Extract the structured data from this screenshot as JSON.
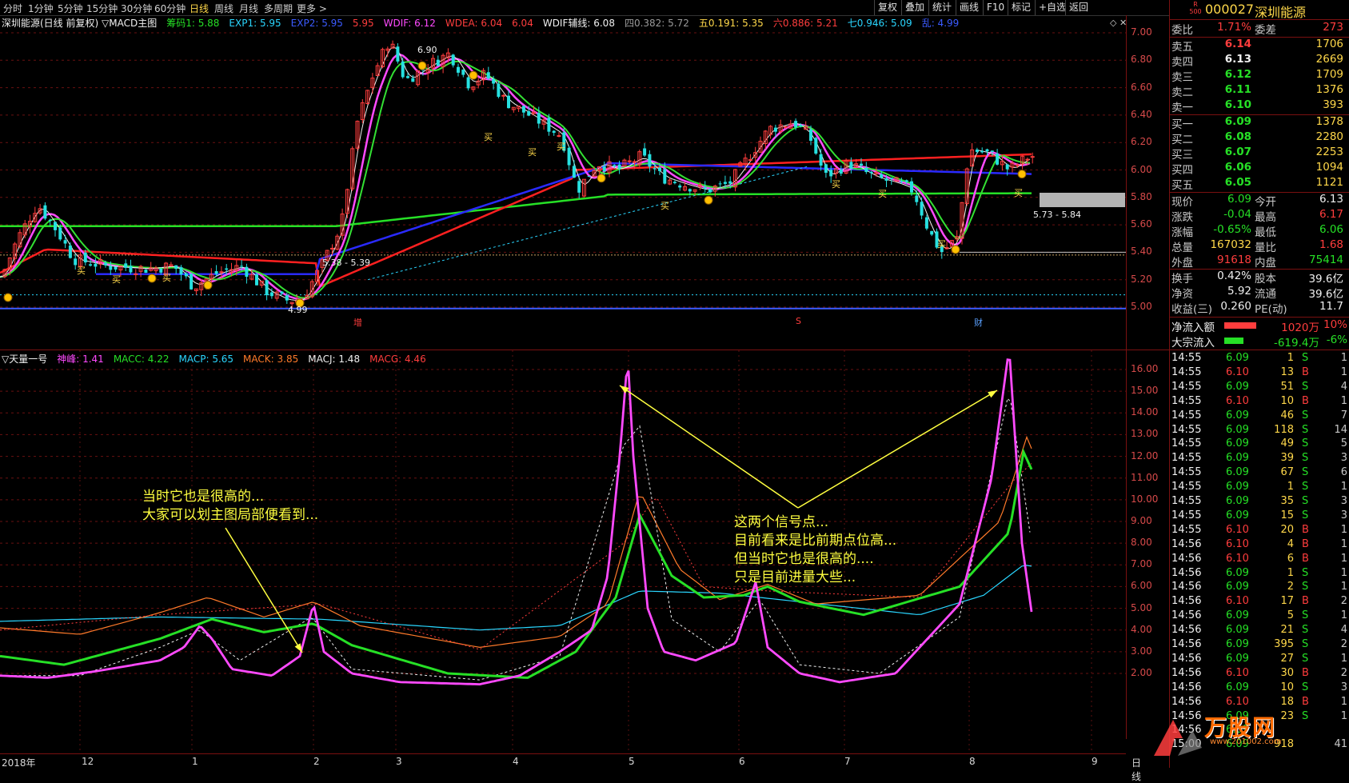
{
  "toolbar": {
    "periods": [
      "分时",
      "1分钟",
      "5分钟",
      "15分钟",
      "30分钟",
      "60分钟",
      "日线",
      "周线",
      "月线",
      "多周期",
      "更多 >"
    ],
    "active_period": "日线",
    "right_buttons": [
      "复权",
      "叠加",
      "统计",
      "画线",
      "F10",
      "标记",
      "+自选",
      "返回"
    ]
  },
  "main_header": {
    "title": "深圳能源(日线 前复权) ▽MACD主图",
    "items": [
      {
        "text": "筹码1: 5.88",
        "color": "#26e026"
      },
      {
        "text": "EXP1: 5.95",
        "color": "#2ad6ff"
      },
      {
        "text": "EXP2: 5.95",
        "color": "#3b5bff"
      },
      {
        "text": "5.95",
        "color": "#ff3d3d"
      },
      {
        "text": "WDIF: 6.12",
        "color": "#ff4aff"
      },
      {
        "text": "WDEA: 6.04",
        "color": "#ff3d3d"
      },
      {
        "text": "6.04",
        "color": "#ff3d3d"
      },
      {
        "text": "WDIF辅线: 6.08",
        "color": "#f0f0f0"
      },
      {
        "text": "四0.382: 5.72",
        "color": "#9a9a9a"
      },
      {
        "text": "五0.191: 5.35",
        "color": "#ffd84a"
      },
      {
        "text": "六0.886: 5.21",
        "color": "#ff3d3d"
      },
      {
        "text": "七0.946: 5.09",
        "color": "#2ad6ff"
      },
      {
        "text": "乱: 4.99",
        "color": "#3b5bff"
      }
    ]
  },
  "main_yaxis": [
    "7.00",
    "6.80",
    "6.60",
    "6.40",
    "6.20",
    "6.00",
    "5.80",
    "5.60",
    "5.40",
    "5.20",
    "5.00"
  ],
  "main_labels": {
    "high": "6.90",
    "low": "4.99",
    "mid": "5.38 - 5.39",
    "range_right": "5.73 - 5.84",
    "buy": "买",
    "marker_zeng": "增",
    "marker_s": "S",
    "marker_cai": "财"
  },
  "ind_header": {
    "title": "▽天量一号",
    "items": [
      {
        "text": "神峰: 1.41",
        "color": "#ff4aff"
      },
      {
        "text": "MACC: 4.22",
        "color": "#26e026"
      },
      {
        "text": "MACP: 5.65",
        "color": "#2ad6ff"
      },
      {
        "text": "MACK: 3.85",
        "color": "#ff7a2a"
      },
      {
        "text": "MACJ: 1.48",
        "color": "#f0f0f0"
      },
      {
        "text": "MACG: 4.46",
        "color": "#ff3d3d"
      }
    ]
  },
  "ind_yaxis": [
    "16.00",
    "15.00",
    "14.00",
    "13.00",
    "12.00",
    "11.00",
    "10.00",
    "9.00",
    "8.00",
    "7.00",
    "6.00",
    "5.00",
    "4.00",
    "3.00",
    "2.00"
  ],
  "annotations": {
    "left_line1": "当时它也是很高的...",
    "left_line2": "大家可以划主图局部便看到...",
    "right_line1": "这两个信号点...",
    "right_line2": "目前看来是比前期点位高...",
    "right_line3": "但当时它也是很高的....",
    "right_line4": "只是目前进量大些..."
  },
  "xaxis": [
    "2018年",
    "12",
    "1",
    "2",
    "3",
    "4",
    "5",
    "6",
    "7",
    "8",
    "9"
  ],
  "xaxis_mode": "日线",
  "panel": {
    "code": "000027",
    "name": "深圳能源",
    "badge_top": "R",
    "badge_bottom": "500",
    "weibi_label": "委比",
    "weibi": "1.71%",
    "weicha_label": "委差",
    "weicha": "273",
    "asks": [
      {
        "label": "卖五",
        "price": "6.14",
        "vol": "1706",
        "pcolor": "#ff3d3d"
      },
      {
        "label": "卖四",
        "price": "6.13",
        "vol": "2669",
        "pcolor": "#f0f0f0"
      },
      {
        "label": "卖三",
        "price": "6.12",
        "vol": "1709",
        "pcolor": "#26e026"
      },
      {
        "label": "卖二",
        "price": "6.11",
        "vol": "1376",
        "pcolor": "#26e026"
      },
      {
        "label": "卖一",
        "price": "6.10",
        "vol": "393",
        "pcolor": "#26e026"
      }
    ],
    "bids": [
      {
        "label": "买一",
        "price": "6.09",
        "vol": "1378",
        "pcolor": "#26e026"
      },
      {
        "label": "买二",
        "price": "6.08",
        "vol": "2280",
        "pcolor": "#26e026"
      },
      {
        "label": "买三",
        "price": "6.07",
        "vol": "2253",
        "pcolor": "#26e026"
      },
      {
        "label": "买四",
        "price": "6.06",
        "vol": "1094",
        "pcolor": "#26e026"
      },
      {
        "label": "买五",
        "price": "6.05",
        "vol": "1121",
        "pcolor": "#26e026"
      }
    ],
    "stats": [
      {
        "l1": "现价",
        "v1": "6.09",
        "c1": "#26e026",
        "l2": "今开",
        "v2": "6.13",
        "c2": "#f0f0f0"
      },
      {
        "l1": "涨跌",
        "v1": "-0.04",
        "c1": "#26e026",
        "l2": "最高",
        "v2": "6.17",
        "c2": "#ff3d3d"
      },
      {
        "l1": "涨幅",
        "v1": "-0.65%",
        "c1": "#26e026",
        "l2": "最低",
        "v2": "6.06",
        "c2": "#26e026"
      },
      {
        "l1": "总量",
        "v1": "167032",
        "c1": "#ffd84a",
        "l2": "量比",
        "v2": "1.68",
        "c2": "#ff3d3d"
      },
      {
        "l1": "外盘",
        "v1": "91618",
        "c1": "#ff3d3d",
        "l2": "内盘",
        "v2": "75414",
        "c2": "#26e026"
      }
    ],
    "stats2": [
      {
        "l1": "换手",
        "v1": "0.42%",
        "c1": "#f0f0f0",
        "l2": "股本",
        "v2": "39.6亿",
        "c2": "#f0f0f0"
      },
      {
        "l1": "净资",
        "v1": "5.92",
        "c1": "#f0f0f0",
        "l2": "流通",
        "v2": "39.6亿",
        "c2": "#f0f0f0"
      },
      {
        "l1": "收益(三)",
        "v1": "0.260",
        "c1": "#f0f0f0",
        "l2": "PE(动)",
        "v2": "11.7",
        "c2": "#f0f0f0"
      }
    ],
    "flow": [
      {
        "label": "净流入额",
        "amount": "1020万",
        "pct": "10%",
        "color": "#ff3d3d",
        "bar": 0.45
      },
      {
        "label": "大宗流入",
        "amount": "-619.4万",
        "pct": "-6%",
        "color": "#26e026",
        "bar": 0.27
      }
    ],
    "ticks": [
      {
        "t": "14:55",
        "p": "6.09",
        "v": "1",
        "d": "S",
        "n": "1"
      },
      {
        "t": "14:55",
        "p": "6.10",
        "v": "13",
        "d": "B",
        "n": "1"
      },
      {
        "t": "14:55",
        "p": "6.09",
        "v": "51",
        "d": "S",
        "n": "4"
      },
      {
        "t": "14:55",
        "p": "6.10",
        "v": "10",
        "d": "B",
        "n": "1"
      },
      {
        "t": "14:55",
        "p": "6.09",
        "v": "46",
        "d": "S",
        "n": "7"
      },
      {
        "t": "14:55",
        "p": "6.09",
        "v": "118",
        "d": "S",
        "n": "14"
      },
      {
        "t": "14:55",
        "p": "6.09",
        "v": "49",
        "d": "S",
        "n": "5"
      },
      {
        "t": "14:55",
        "p": "6.09",
        "v": "39",
        "d": "S",
        "n": "3"
      },
      {
        "t": "14:55",
        "p": "6.09",
        "v": "67",
        "d": "S",
        "n": "6"
      },
      {
        "t": "14:55",
        "p": "6.09",
        "v": "1",
        "d": "S",
        "n": "1"
      },
      {
        "t": "14:55",
        "p": "6.09",
        "v": "35",
        "d": "S",
        "n": "3"
      },
      {
        "t": "14:55",
        "p": "6.09",
        "v": "15",
        "d": "S",
        "n": "3"
      },
      {
        "t": "14:55",
        "p": "6.10",
        "v": "20",
        "d": "B",
        "n": "1"
      },
      {
        "t": "14:56",
        "p": "6.10",
        "v": "4",
        "d": "B",
        "n": "1"
      },
      {
        "t": "14:56",
        "p": "6.10",
        "v": "6",
        "d": "B",
        "n": "1"
      },
      {
        "t": "14:56",
        "p": "6.09",
        "v": "1",
        "d": "S",
        "n": "1"
      },
      {
        "t": "14:56",
        "p": "6.09",
        "v": "2",
        "d": "S",
        "n": "1"
      },
      {
        "t": "14:56",
        "p": "6.10",
        "v": "17",
        "d": "B",
        "n": "2"
      },
      {
        "t": "14:56",
        "p": "6.09",
        "v": "5",
        "d": "S",
        "n": "1"
      },
      {
        "t": "14:56",
        "p": "6.09",
        "v": "21",
        "d": "S",
        "n": "4"
      },
      {
        "t": "14:56",
        "p": "6.09",
        "v": "395",
        "d": "S",
        "n": "2"
      },
      {
        "t": "14:56",
        "p": "6.09",
        "v": "27",
        "d": "S",
        "n": "1"
      },
      {
        "t": "14:56",
        "p": "6.10",
        "v": "30",
        "d": "B",
        "n": "2"
      },
      {
        "t": "14:56",
        "p": "6.09",
        "v": "10",
        "d": "S",
        "n": "3"
      },
      {
        "t": "14:56",
        "p": "6.10",
        "v": "18",
        "d": "B",
        "n": "1"
      },
      {
        "t": "14:56",
        "p": "6.09",
        "v": "23",
        "d": "S",
        "n": "1"
      },
      {
        "t": "14:56",
        "p": "6.09",
        "v": "",
        "d": "",
        "n": ""
      },
      {
        "t": "15:00",
        "p": "6.09",
        "v": "918",
        "d": "",
        "n": "41"
      }
    ],
    "watermark": "万股网",
    "watermark_url": "www.201002.com"
  },
  "colors": {
    "up": "#ff3d3d",
    "down": "#26e0e0",
    "green_line": "#26e026",
    "magenta": "#ff4aff",
    "blue_line": "#2a2aff",
    "annotation": "#ffff40"
  }
}
